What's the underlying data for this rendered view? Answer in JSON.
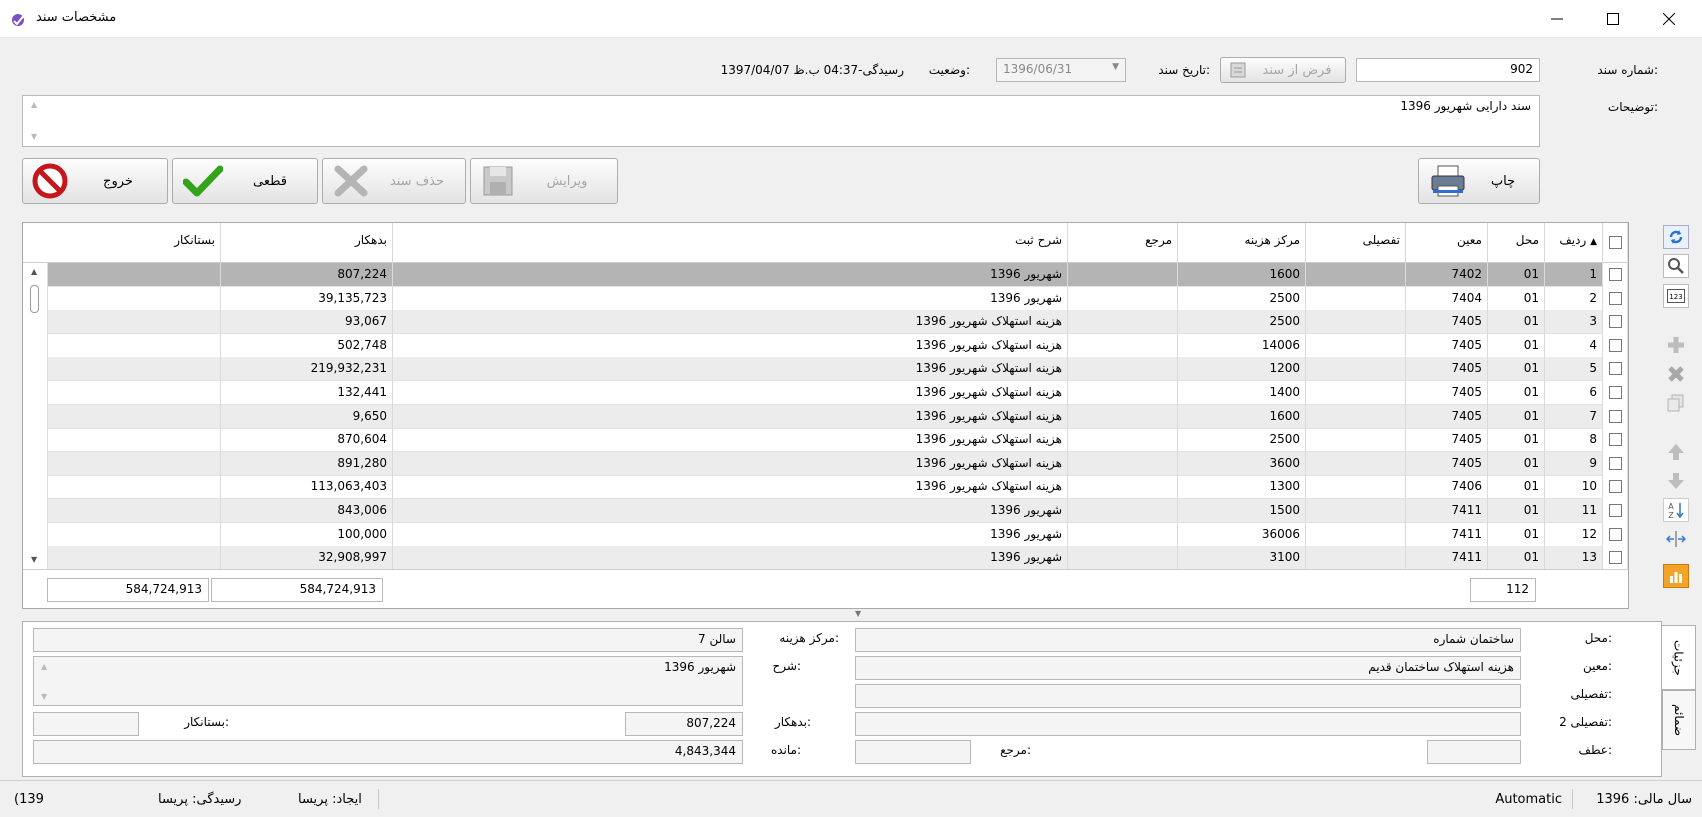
{
  "window": {
    "title": "مشخصات سند"
  },
  "header": {
    "doc_number_label": "شماره سند:",
    "doc_number": "902",
    "assume_button": "فرض از سند",
    "date_label": "تاریخ سند:",
    "date_value": "1396/06/31",
    "status_label": "وضعیت:",
    "status_value": "رسیدگی-04:37 ب.ظ 1397/04/07",
    "desc_label": "توضیحات:",
    "desc_value": "سند دارایی شهریور 1396"
  },
  "actions": {
    "print": "چاپ",
    "edit": "ویرایش",
    "delete": "حذف سند",
    "final": "قطعی",
    "exit": "خروج"
  },
  "grid": {
    "columns": {
      "row": "ردیف",
      "location": "محل",
      "moein": "معین",
      "tafsili": "تفصیلی",
      "cost_center": "مرکز هزینه",
      "reference": "مرجع",
      "description": "شرح ثبت",
      "debit": "بدهکار",
      "credit": "بستانکار"
    },
    "rows": [
      {
        "row": "1",
        "location": "01",
        "moein": "7402",
        "tafsili": "",
        "cost_center": "1600",
        "reference": "",
        "description": "شهریور 1396",
        "debit": "807,224",
        "credit": ""
      },
      {
        "row": "2",
        "location": "01",
        "moein": "7404",
        "tafsili": "",
        "cost_center": "2500",
        "reference": "",
        "description": "شهریور 1396",
        "debit": "39,135,723",
        "credit": ""
      },
      {
        "row": "3",
        "location": "01",
        "moein": "7405",
        "tafsili": "",
        "cost_center": "2500",
        "reference": "",
        "description": "هزینه استهلاک  شهریور 1396",
        "debit": "93,067",
        "credit": ""
      },
      {
        "row": "4",
        "location": "01",
        "moein": "7405",
        "tafsili": "",
        "cost_center": "14006",
        "reference": "",
        "description": "هزینه استهلاک  شهریور 1396",
        "debit": "502,748",
        "credit": ""
      },
      {
        "row": "5",
        "location": "01",
        "moein": "7405",
        "tafsili": "",
        "cost_center": "1200",
        "reference": "",
        "description": "هزینه استهلاک  شهریور 1396",
        "debit": "219,932,231",
        "credit": ""
      },
      {
        "row": "6",
        "location": "01",
        "moein": "7405",
        "tafsili": "",
        "cost_center": "1400",
        "reference": "",
        "description": "هزینه استهلاک  شهریور 1396",
        "debit": "132,441",
        "credit": ""
      },
      {
        "row": "7",
        "location": "01",
        "moein": "7405",
        "tafsili": "",
        "cost_center": "1600",
        "reference": "",
        "description": "هزینه استهلاک  شهریور 1396",
        "debit": "9,650",
        "credit": ""
      },
      {
        "row": "8",
        "location": "01",
        "moein": "7405",
        "tafsili": "",
        "cost_center": "2500",
        "reference": "",
        "description": "هزینه استهلاک  شهریور 1396",
        "debit": "870,604",
        "credit": ""
      },
      {
        "row": "9",
        "location": "01",
        "moein": "7405",
        "tafsili": "",
        "cost_center": "3600",
        "reference": "",
        "description": "هزینه استهلاک  شهریور 1396",
        "debit": "891,280",
        "credit": ""
      },
      {
        "row": "10",
        "location": "01",
        "moein": "7406",
        "tafsili": "",
        "cost_center": "1300",
        "reference": "",
        "description": "هزینه استهلاک  شهریور 1396",
        "debit": "113,063,403",
        "credit": ""
      },
      {
        "row": "11",
        "location": "01",
        "moein": "7411",
        "tafsili": "",
        "cost_center": "1500",
        "reference": "",
        "description": "شهریور 1396",
        "debit": "843,006",
        "credit": ""
      },
      {
        "row": "12",
        "location": "01",
        "moein": "7411",
        "tafsili": "",
        "cost_center": "36006",
        "reference": "",
        "description": "شهریور 1396",
        "debit": "100,000",
        "credit": ""
      },
      {
        "row": "13",
        "location": "01",
        "moein": "7411",
        "tafsili": "",
        "cost_center": "3100",
        "reference": "",
        "description": "شهریور 1396",
        "debit": "32,908,997",
        "credit": ""
      }
    ],
    "footer": {
      "count": "112",
      "debit_total": "584,724,913",
      "credit_total": "584,724,913"
    }
  },
  "detail": {
    "location_label": "محل:",
    "location_value": "ساختمان شماره",
    "moein_label": "معین:",
    "moein_value": "هزینه استهلاک ساختمان قدیم",
    "tafsili_label": "تفصیلی:",
    "tafsili2_label": "تفصیلی 2:",
    "atf_label": "عطف:",
    "ref_label": "مرجع:",
    "cost_center_label": "مرکز هزینه:",
    "cost_center_value": "سالن 7",
    "desc_label": "شرح:",
    "desc_value": "شهریور 1396",
    "debit_label": "بدهکار:",
    "debit_value": "807,224",
    "credit_label": "بستانکار:",
    "balance_label": "مانده:",
    "balance_value": "4,843,344",
    "tab_details": "جزئیات",
    "tab_attachments": "ضمائم"
  },
  "statusbar": {
    "fiscal_year": "سال مالی: 1396",
    "mode": "Automatic",
    "created": "ایجاد: پریسا",
    "reviewed": "رسیدگی: پریسا",
    "cut": "(139"
  },
  "colors": {
    "selected_row": "#b4b4b4",
    "alt_row": "#ececec",
    "tool_accent": "#3a7bd5"
  }
}
